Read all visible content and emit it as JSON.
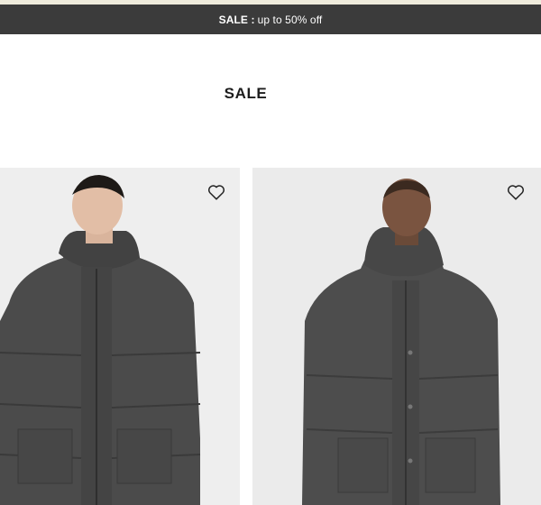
{
  "promo": {
    "strong": "SALE :",
    "text": "up to 50% off"
  },
  "page": {
    "title": "SALE"
  },
  "products": [
    {
      "wishlist_icon": "heart-outline-icon"
    },
    {
      "wishlist_icon": "heart-outline-icon"
    }
  ],
  "colors": {
    "promo_bar": "#3b3b3b",
    "top_strip": "#efebdc",
    "card_bg": "#eeeeee",
    "jacket": "#4a4a4a"
  }
}
